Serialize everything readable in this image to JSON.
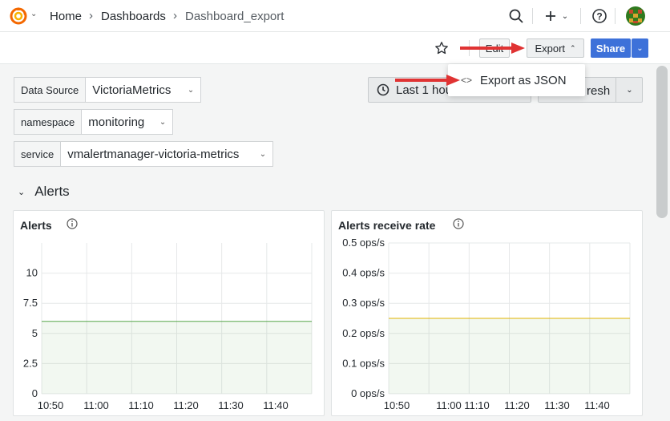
{
  "breadcrumb": [
    "Home",
    "Dashboards",
    "Dashboard_export"
  ],
  "toolbar": {
    "edit_label": "Edit",
    "export_label": "Export",
    "share_label": "Share"
  },
  "export_menu": {
    "item_label": "Export as JSON"
  },
  "variables": [
    {
      "label": "Data Source",
      "value": "VictoriaMetrics"
    },
    {
      "label": "namespace",
      "value": "monitoring"
    },
    {
      "label": "service",
      "value": "vmalertmanager-victoria-metrics"
    }
  ],
  "time_picker": {
    "label": "Last 1 hou"
  },
  "refresh": {
    "label": "resh"
  },
  "row": {
    "title": "Alerts"
  },
  "colors": {
    "share_blue": "#3d71d9",
    "annotation_red": "#e03333",
    "green_series": "#56a64b",
    "yellow_series": "#e0b400"
  },
  "panels": [
    {
      "title": "Alerts"
    },
    {
      "title": "Alerts receive rate"
    }
  ],
  "chart_data": [
    {
      "type": "area",
      "title": "Alerts",
      "x": [
        "10:50",
        "11:00",
        "11:10",
        "11:20",
        "11:30",
        "11:40"
      ],
      "yticks": [
        "0",
        "2.5",
        "5",
        "7.5",
        "10"
      ],
      "ylim": [
        0,
        12.5
      ],
      "series": [
        {
          "values": [
            6,
            6,
            6,
            6,
            6,
            6
          ],
          "color": "#56a64b"
        }
      ],
      "grid": true
    },
    {
      "type": "area",
      "title": "Alerts receive rate",
      "x": [
        "10:50",
        "11:00",
        "11:10",
        "11:20",
        "11:30",
        "11:40"
      ],
      "yticks": [
        "0 ops/s",
        "0.1 ops/s",
        "0.2 ops/s",
        "0.3 ops/s",
        "0.4 ops/s",
        "0.5 ops/s"
      ],
      "ylim": [
        0,
        0.5
      ],
      "series": [
        {
          "values": [
            0.25,
            0.25,
            0.25,
            0.25,
            0.25,
            0.25
          ],
          "color": "#e0b400"
        }
      ],
      "grid": true
    }
  ]
}
